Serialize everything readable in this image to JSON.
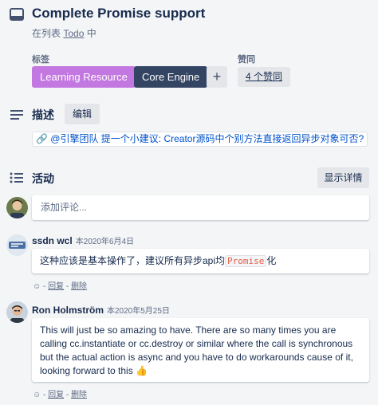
{
  "card": {
    "title": "Complete Promise support",
    "in_list_prefix": "在列表",
    "list_name": "Todo",
    "in_list_suffix": "中"
  },
  "labels": {
    "heading": "标签",
    "items": [
      {
        "text": "Learning Resource",
        "color": "#c377e0"
      },
      {
        "text": "Core Engine",
        "color": "#344563"
      }
    ],
    "add_symbol": "+"
  },
  "votes": {
    "heading": "赞同",
    "button_label": "4 个赞同"
  },
  "description": {
    "heading": "描述",
    "edit_label": "编辑",
    "link_text": "🔗 @引擎团队 提一个小建议: Creator源码中个别方法直接返回异步对象可否?"
  },
  "activity": {
    "heading": "活动",
    "details_label": "显示详情",
    "input_placeholder": "添加评论..."
  },
  "comments": [
    {
      "author": "ssdn wcl",
      "date": "本2020年6月4日",
      "text_before": "这种应该是基本操作了，建议所有异步api均",
      "code": "Promise",
      "text_after": "化",
      "reply": "回复",
      "delete": "删除",
      "separator": "-"
    },
    {
      "author": "Ron Holmström",
      "date": "本2020年5月25日",
      "text": "This will just be so amazing to have. There are so many times you are calling cc.instantiate or cc.destroy or similar where the call is synchronous but the actual action is async and you have to do workarounds cause of it, looking forward to this 👍",
      "reply": "回复",
      "delete": "删除",
      "separator": "-"
    }
  ],
  "colors": {
    "background": "#f4f5f7",
    "label_purple": "#c377e0",
    "label_dark": "#344563",
    "link_blue": "#0052cc",
    "code_red": "#eb5a46"
  }
}
